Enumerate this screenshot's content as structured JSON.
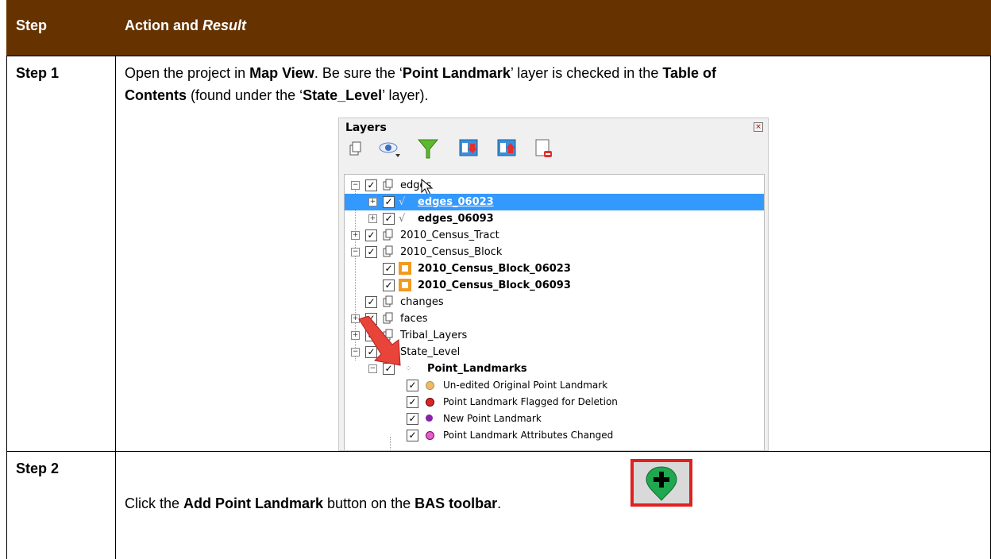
{
  "header": {
    "step": "Step",
    "action_plain": "Action and ",
    "action_italic": "Result"
  },
  "colors": {
    "header_bg": "#663300",
    "header_text": "#ffffff",
    "selection": "#3399ff",
    "arrow": "#e8443a",
    "button_border": "#e02020",
    "button_icon": "#1fa84f"
  },
  "steps": [
    {
      "label": "Step 1",
      "line1": [
        "Open the project in ",
        "Map View",
        ". Be sure the ‘",
        "Point Landmark",
        "’ layer is checked in the ",
        "Table of"
      ],
      "line2": [
        "Contents",
        " (found under the ‘",
        "State_Level",
        "’ layer)."
      ]
    },
    {
      "label": "Step 2",
      "line": [
        "Click the ",
        "Add Point Landmark",
        " button on the ",
        "BAS toolbar",
        "."
      ]
    }
  ],
  "layers_panel": {
    "title": "Layers",
    "close_icon": "close-icon",
    "toolbar_icons": [
      "add-group-icon",
      "eye-icon",
      "filter-icon",
      "expand-all-icon",
      "collapse-all-icon",
      "remove-layer-icon"
    ],
    "rows": [
      {
        "label": "edges",
        "type": "group",
        "bold": false
      },
      {
        "label": "edges_06023",
        "type": "line",
        "bold": true,
        "selected": true
      },
      {
        "label": "edges_06093",
        "type": "line",
        "bold": true
      },
      {
        "label": "2010_Census_Tract",
        "type": "group",
        "bold": false
      },
      {
        "label": "2010_Census_Block",
        "type": "group",
        "bold": false
      },
      {
        "label": "2010_Census_Block_06023",
        "type": "polygon",
        "bold": true
      },
      {
        "label": "2010_Census_Block_06093",
        "type": "polygon",
        "bold": true
      },
      {
        "label": "changes",
        "type": "group",
        "bold": false
      },
      {
        "label": "faces",
        "type": "group",
        "bold": false
      },
      {
        "label": "Tribal_Layers",
        "type": "group",
        "bold": false
      },
      {
        "label": "State_Level",
        "type": "group",
        "bold": false
      },
      {
        "label": "Point_Landmarks",
        "type": "point",
        "bold": true
      },
      {
        "label": "Un-edited Original Point Landmark",
        "type": "legend",
        "color": "#f4b860"
      },
      {
        "label": "Point Landmark Flagged for Deletion",
        "type": "legend",
        "color": "#d9252a"
      },
      {
        "label": "New Point Landmark",
        "type": "legend",
        "color": "#8b1fa9"
      },
      {
        "label": "Point Landmark Attributes Changed",
        "type": "legend",
        "color": "#e060c8"
      }
    ]
  }
}
